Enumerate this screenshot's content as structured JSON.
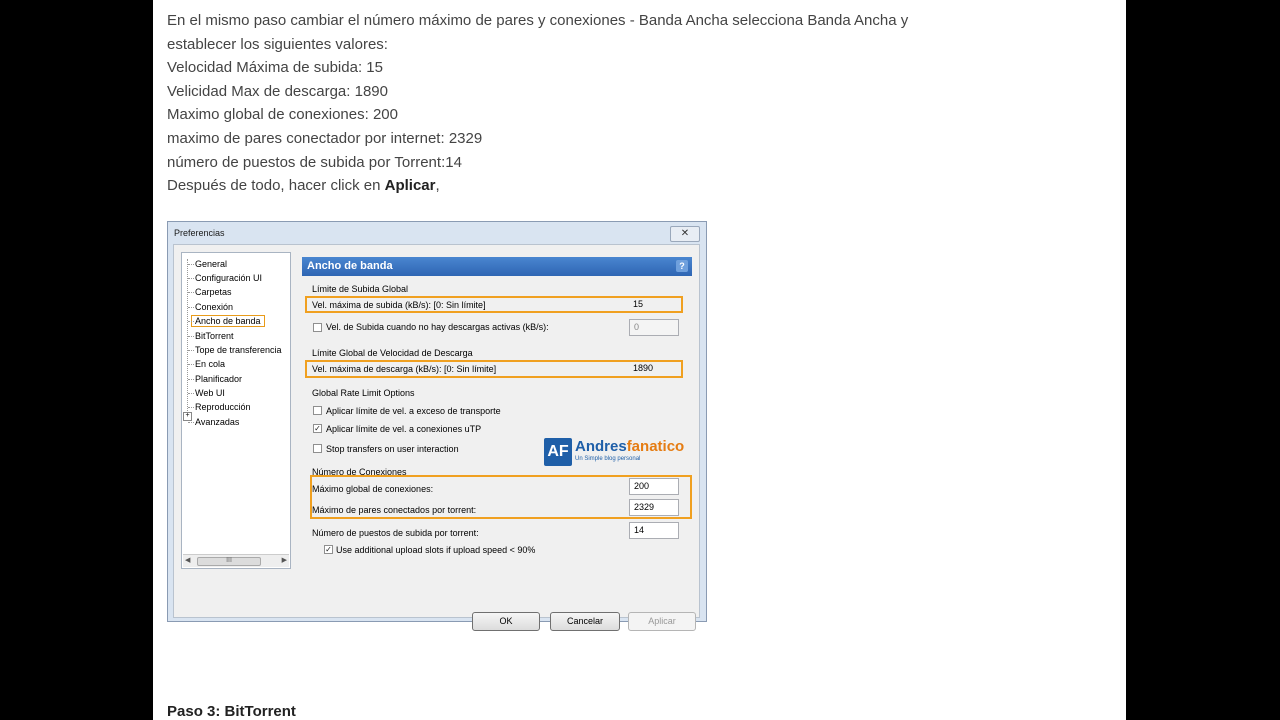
{
  "article": {
    "lines": [
      "En el mismo paso cambiar el número máximo de pares y conexiones - Banda Ancha selecciona Banda Ancha y",
      "establecer los siguientes valores:",
      "Velocidad Máxima de subida: 15",
      "Velicidad Max de descarga: 1890",
      "Maximo global de conexiones: 200",
      "maximo de pares conectador por internet: 2329",
      "número de puestos de subida por Torrent:14"
    ],
    "last_line_prefix": "Después de todo, hacer click en ",
    "last_line_bold": "Aplicar",
    "last_line_suffix": ",",
    "next_heading": "Paso 3: BitTorrent"
  },
  "dialog": {
    "title": "Preferencias",
    "close_glyph": "✕",
    "tree": [
      "General",
      "Configuración UI",
      "Carpetas",
      "Conexión",
      "Ancho de banda",
      "BitTorrent",
      "Tope de transferencia",
      "En cola",
      "Planificador",
      "Web UI",
      "Reproducción",
      "Avanzadas"
    ],
    "selected_item": "Ancho de banda",
    "panel_title": "Ancho de banda",
    "help_glyph": "?",
    "upload_group": "Límite de Subida Global",
    "upload_max_label": "Vel. máxima de subida (kB/s): [0: Sin límite]",
    "upload_max_value": "15",
    "upload_idle_label": "Vel. de Subida cuando no hay descargas activas (kB/s):",
    "upload_idle_value": "0",
    "download_group": "Límite Global de Velocidad de Descarga",
    "download_max_label": "Vel. máxima de descarga (kB/s): [0: Sin límite]",
    "download_max_value": "1890",
    "rate_group": "Global Rate Limit Options",
    "rate_opt1": "Aplicar límite de vel. a exceso de transporte",
    "rate_opt1_checked": false,
    "rate_opt2": "Aplicar límite de vel. a conexiones uTP",
    "rate_opt2_checked": true,
    "rate_opt3": "Stop transfers on user interaction",
    "rate_opt3_checked": false,
    "conn_group": "Número de Conexiones",
    "global_conn_label": "Máximo global de conexiones:",
    "global_conn_value": "200",
    "peers_label": "Máximo de pares conectados por torrent:",
    "peers_value": "2329",
    "slots_label": "Número de puestos de subida por torrent:",
    "slots_value": "14",
    "extra_slots_label": "Use additional upload slots if upload speed < 90%",
    "extra_slots_checked": true,
    "ok_label": "OK",
    "cancel_label": "Cancelar",
    "apply_label": "Aplicar",
    "check_glyph": "✓",
    "scroll_thumb": "III",
    "expander": "+"
  },
  "watermark": {
    "initials": "AF",
    "name_a": "Andres",
    "name_b": "fanatico",
    "tagline": "Un Simple blog personal"
  },
  "colors": {
    "highlight": "#f0a020",
    "banner": "#2e65b3",
    "logo_blue": "#1f5fa8",
    "logo_orange": "#e57c12"
  }
}
